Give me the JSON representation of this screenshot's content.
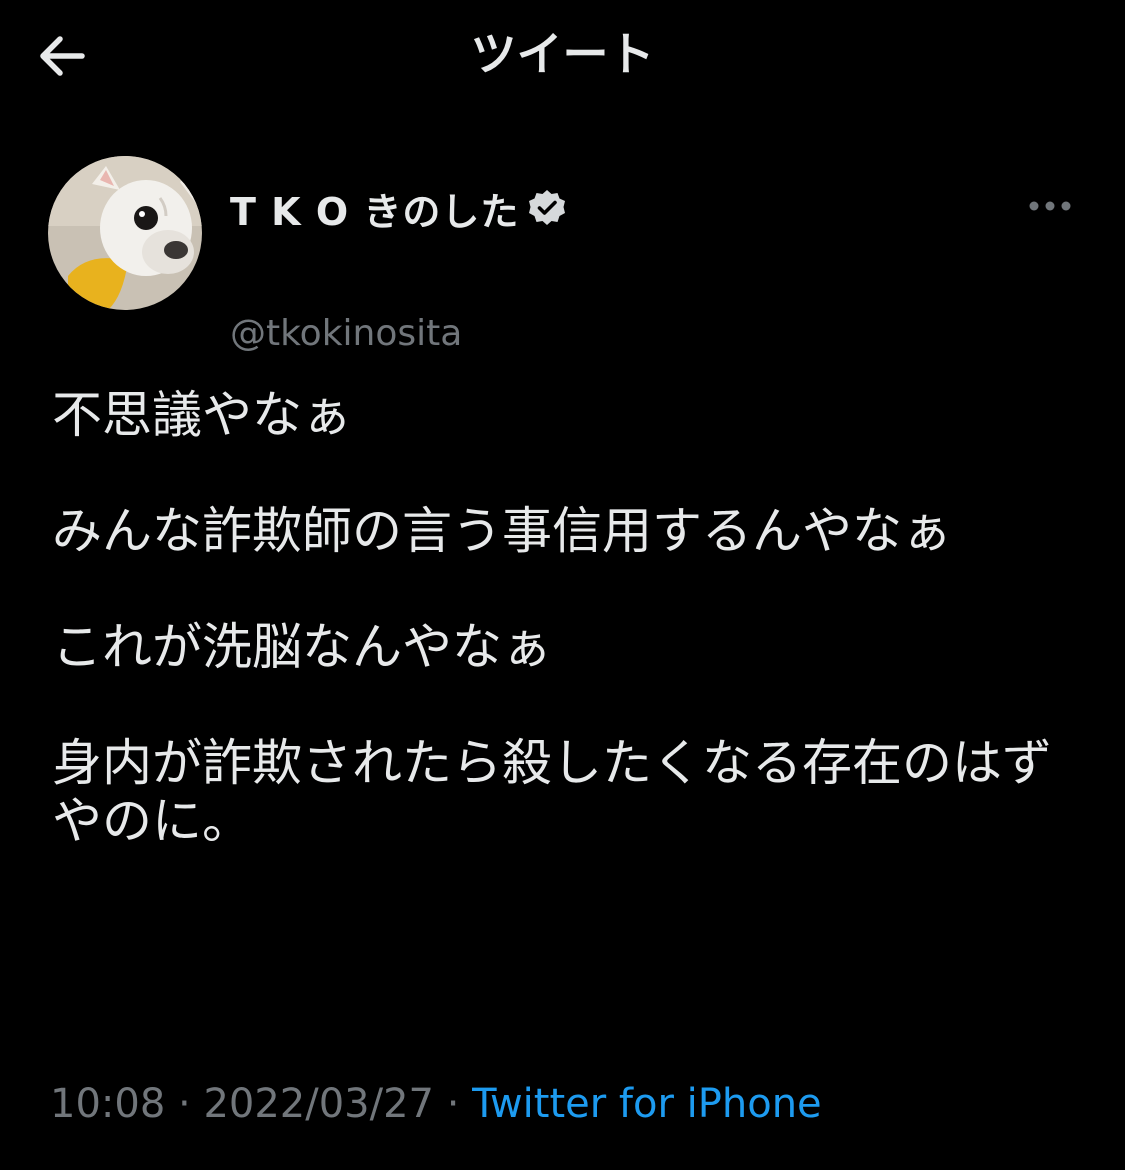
{
  "header": {
    "title": "ツイート",
    "back_icon": "arrow-left-icon"
  },
  "tweet": {
    "author": {
      "display_name": "T K O きのした",
      "handle": "@tkokinosita",
      "verified": true,
      "avatar": "dog-avatar"
    },
    "more_icon": "more-dots-icon",
    "paragraphs": [
      "不思議やなぁ",
      "みんな詐欺師の言う事信用するんやなぁ",
      "これが洗脳なんやなぁ",
      "身内が詐欺されたら殺したくなる存在のはずやのに。"
    ],
    "time": "10:08",
    "separator": " · ",
    "date": "2022/03/27",
    "source": "Twitter for iPhone"
  },
  "colors": {
    "background": "#000000",
    "text_primary": "#e7e9ea",
    "text_secondary": "#71767b",
    "accent": "#1d9bf0"
  }
}
